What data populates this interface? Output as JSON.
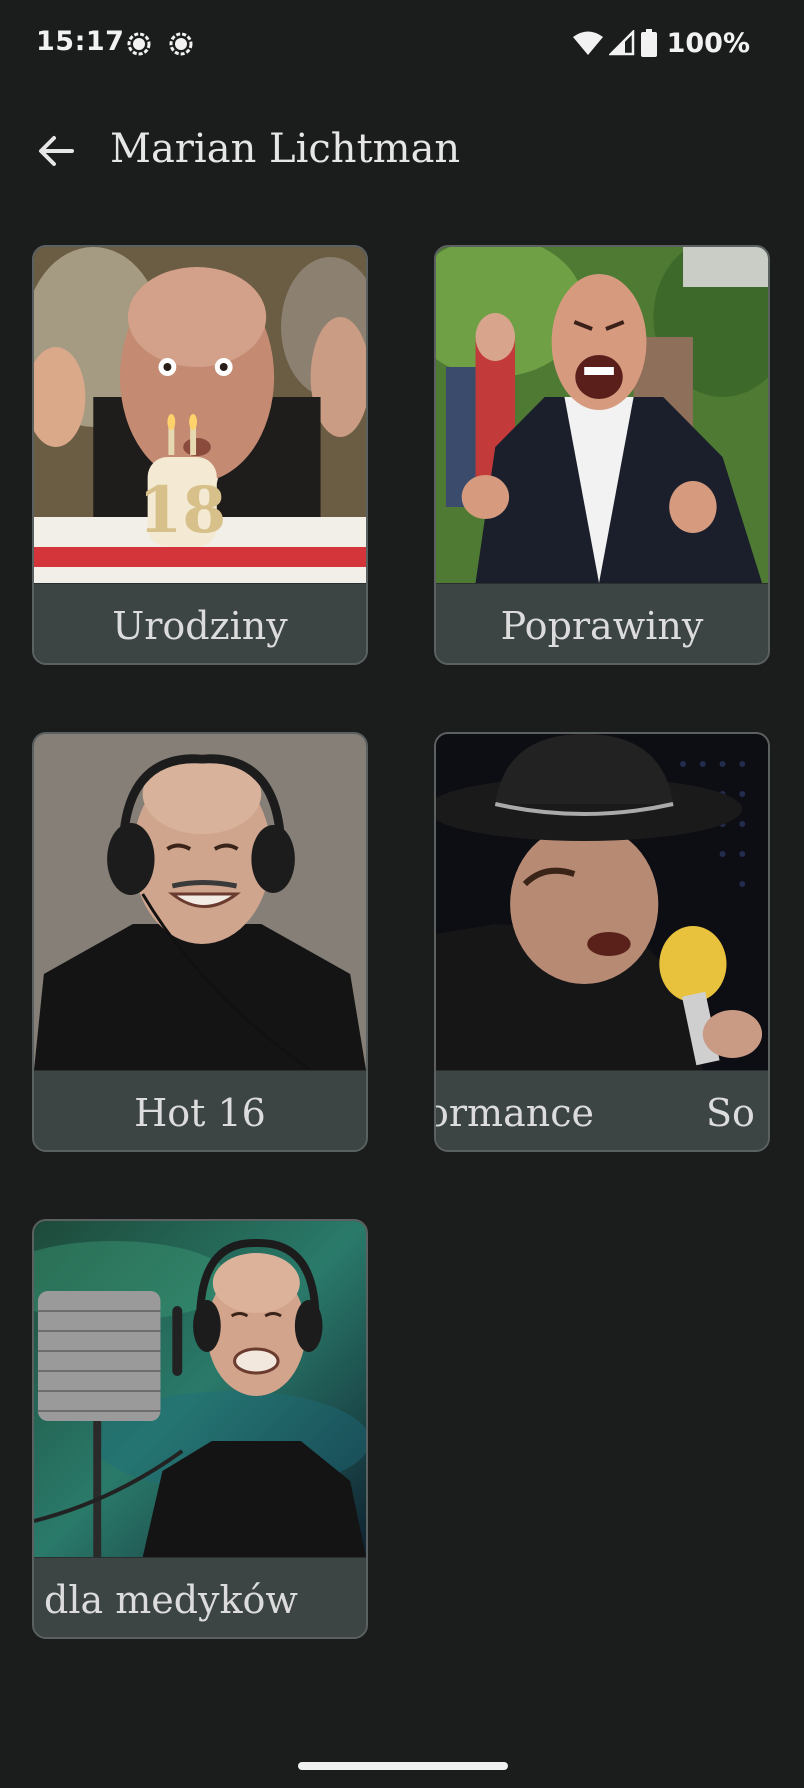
{
  "status_bar": {
    "time": "15:17",
    "notifications": [
      "signal-icon",
      "signal-icon"
    ],
    "battery": "100%"
  },
  "app_bar": {
    "title": "Marian Lichtman"
  },
  "cards": [
    {
      "label": "Urodziny",
      "cake_number": "18"
    },
    {
      "label": "Poprawiny"
    },
    {
      "label": "Hot 16"
    },
    {
      "label": "ormance",
      "label_tail": "So"
    },
    {
      "label": "dla medyków"
    }
  ],
  "colors": {
    "background": "#1b1c1c",
    "card_caption": "#3c4544",
    "card_border": "#5b6060"
  }
}
